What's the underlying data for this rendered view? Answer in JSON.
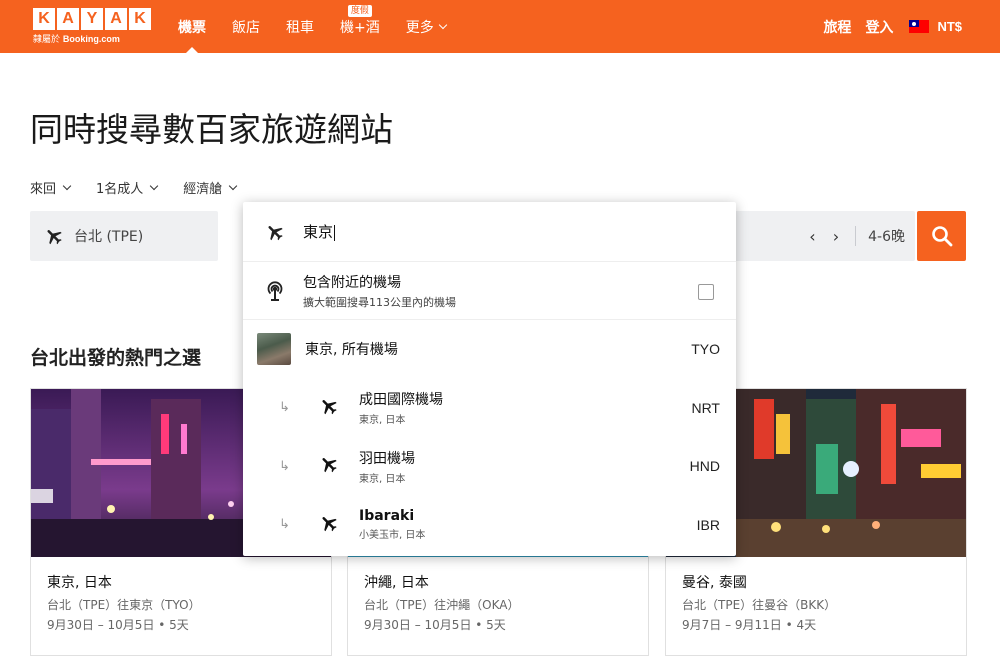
{
  "header": {
    "logo_letters": [
      "K",
      "A",
      "Y",
      "A",
      "K"
    ],
    "logo_tagline_a": "隸屬於",
    "logo_tagline_b": "Booking.com",
    "nav": [
      {
        "label": "機票",
        "active": true
      },
      {
        "label": "飯店",
        "active": false
      },
      {
        "label": "租車",
        "active": false
      },
      {
        "label": "機+酒",
        "active": false,
        "badge": "度假"
      },
      {
        "label": "更多",
        "active": false,
        "has_chevron": true
      }
    ],
    "trips_label": "旅程",
    "login_label": "登入",
    "currency": "NT$"
  },
  "hero": {
    "title": "同時搜尋數百家旅遊網站",
    "trip_type": "來回",
    "passengers": "1名成人",
    "cabin": "經濟艙"
  },
  "search": {
    "origin": "台北 (TPE)",
    "destination_input": "東京",
    "nights": "4-6晚"
  },
  "dropdown": {
    "nearby_title": "包含附近的機場",
    "nearby_subtitle": "擴大範圍搜尋113公里內的機場",
    "all_airports": {
      "name": "東京, 所有機場",
      "code": "TYO"
    },
    "airports": [
      {
        "name": "成田國際機場",
        "location": "東京, 日本",
        "code": "NRT"
      },
      {
        "name": "羽田機場",
        "location": "東京, 日本",
        "code": "HND"
      },
      {
        "name": "Ibaraki",
        "location": "小美玉市, 日本",
        "code": "IBR"
      }
    ]
  },
  "popular": {
    "title": "台北出發的熱門之選",
    "cards": [
      {
        "title": "東京, 日本",
        "route": "台北（TPE）往東京（TYO）",
        "dates": "9月30日 – 10月5日 • 5天"
      },
      {
        "title": "沖繩, 日本",
        "route": "台北（TPE）往沖繩（OKA）",
        "dates": "9月30日 – 10月5日 • 5天"
      },
      {
        "title": "曼谷, 泰國",
        "route": "台北（TPE）往曼谷（BKK）",
        "dates": "9月7日 – 9月11日 • 4天"
      }
    ]
  },
  "colors": {
    "brand": "#f5621f",
    "field_bg": "#eff0f2"
  }
}
